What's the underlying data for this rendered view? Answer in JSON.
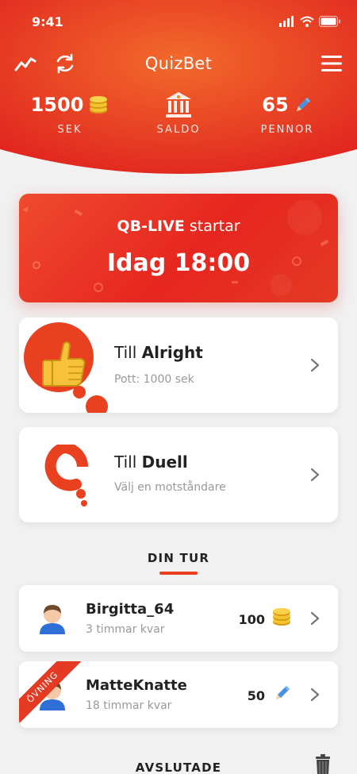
{
  "status_bar": {
    "time": "9:41"
  },
  "header": {
    "title": "QuizBet",
    "stats": {
      "sek": {
        "value": "1500",
        "label": "SEK"
      },
      "saldo": {
        "label": "SALDO"
      },
      "pennor": {
        "value": "65",
        "label": "PENNOR"
      }
    }
  },
  "live_banner": {
    "brand": "QB-LIVE",
    "suffix": " startar",
    "when": "Idag 18:00"
  },
  "cards": [
    {
      "prefix": "Till ",
      "title": "Alright",
      "subtitle": "Pott: 1000 sek"
    },
    {
      "prefix": "Till ",
      "title": "Duell",
      "subtitle": "Välj en motståndare"
    }
  ],
  "din_tur": {
    "title": "DIN TUR",
    "games": [
      {
        "name": "Birgitta_64",
        "time_left": "3 timmar kvar",
        "amount": "100",
        "currency_icon": "coins-icon"
      },
      {
        "name": "MatteKnatte",
        "time_left": "18 timmar kvar",
        "amount": "50",
        "currency_icon": "pencil-icon",
        "ribbon": "ÖVNING"
      }
    ]
  },
  "avslutade": {
    "title": "AVSLUTADE"
  },
  "colors": {
    "accent": "#e9401f",
    "header_top": "#f05a2a",
    "header_bottom": "#e0261f"
  }
}
